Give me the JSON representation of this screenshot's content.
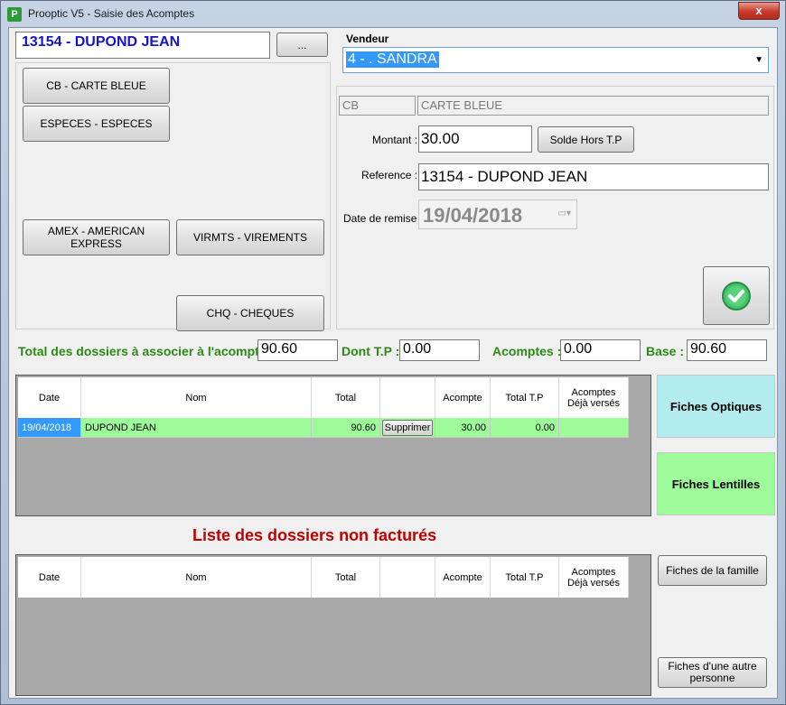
{
  "window": {
    "title": "Prooptic V5 - Saisie des Acomptes",
    "app_icon": "P",
    "close": "x"
  },
  "client": {
    "name": "13154 - DUPOND JEAN",
    "browse_label": "..."
  },
  "payment_methods": {
    "cb": "CB - CARTE BLEUE",
    "especes": "ESPECES - ESPECES",
    "amex": "AMEX - AMERICAN EXPRESS",
    "virmts": "VIRMTS - VIREMENTS",
    "chq": "CHQ - CHEQUES"
  },
  "vendeur": {
    "label": "Vendeur",
    "value": "4 - . SANDRA"
  },
  "payment": {
    "code": "CB",
    "description": "CARTE BLEUE",
    "montant_label": "Montant :",
    "montant": "30.00",
    "solde_button": "Solde Hors T.P",
    "reference_label": "Reference :",
    "reference": "13154 - DUPOND JEAN",
    "date_label": "Date de remise :",
    "date": "19/04/2018"
  },
  "totals": {
    "total_label": "Total des  dossiers à associer à l'acompte",
    "total": "90.60",
    "tp_label": "Dont T.P :",
    "tp": "0.00",
    "acomptes_label": "Acomptes :",
    "acomptes": "0.00",
    "base_label": "Base :",
    "base": "90.60"
  },
  "grid_columns": {
    "date": "Date",
    "nom": "Nom",
    "total": "Total",
    "acompte": "Acompte",
    "total_tp": "Total T.P",
    "deja_1": "Acomptes",
    "deja_2": "Déjà versés"
  },
  "dossiers": [
    {
      "date": "19/04/2018",
      "nom": "DUPOND JEAN",
      "total": "90.60",
      "action": "Supprimer",
      "acompte": "30.00",
      "total_tp": "0.00",
      "deja": ""
    }
  ],
  "side": {
    "optiques": "Fiches Optiques",
    "lentilles": "Fiches Lentilles",
    "famille": "Fiches de la famille",
    "autre_1": "Fiches d'une autre",
    "autre_2": "personne",
    "colors": {
      "optiques": "#b3ecef",
      "lentilles": "#9dfb9a"
    }
  },
  "non_factures": {
    "title": "Liste des dossiers non facturés",
    "color": "#c00000"
  },
  "icons": {
    "validate": "check-circle-icon",
    "dropdown": "chevron-down-icon",
    "calendar": "calendar-icon"
  }
}
